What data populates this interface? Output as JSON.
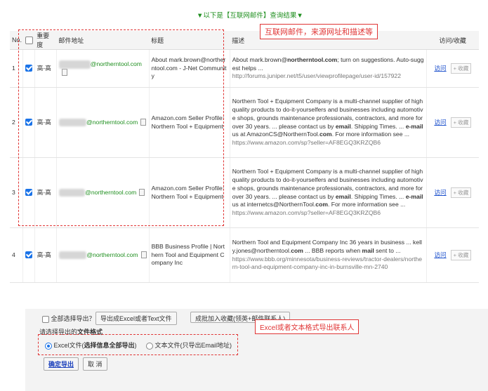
{
  "banner": "▼以下是【互联网邮件】查询结果▼",
  "columns": {
    "no": "No.",
    "importance": "重要度",
    "email": "邮件地址",
    "title": "标题",
    "desc": "描述",
    "action": "访问/收藏"
  },
  "rows": [
    {
      "no": "1",
      "importance": "高-高",
      "email_hidden": "mark.brown",
      "email_visible": "@northerntool.com",
      "title": "About mark.brown@northerntool.com - J-Net Community",
      "desc_html": "About mark.brown@<b>northerntool.com</b>; turn on suggestions. Auto-suggest helps ...",
      "url": "http://forums.juniper.net/t5/user/viewprofilepage/user-id/157922",
      "visit": "访问",
      "fav": "+ 收藏"
    },
    {
      "no": "2",
      "importance": "高-高",
      "email_hidden": "amazoncs",
      "email_visible": "@northerntool.com",
      "title": "Amazon.com Seller Profile: Northern Tool + Equipment",
      "desc_html": "Northern Tool + Equipment Company is a multi-channel supplier of high quality products to do-it-yourselfers and businesses including automotive shops, grounds maintenance professionals, contractors, and more for over 30 years. ... please contact us by <b>email</b>. Shipping Times. ... <b>e-mail</b> us at AmazonCS@NorthernTool.<b>com</b>. For more information see ...",
      "url": "https://www.amazon.com/sp?seller=AF8EGQ3KRZQB6",
      "visit": "访问",
      "fav": "+ 收藏"
    },
    {
      "no": "3",
      "importance": "高-高",
      "email_hidden": "internetcs",
      "email_visible": "@northerntool.com",
      "title": "Amazon.com Seller Profile: Northern Tool + Equipment",
      "desc_html": "Northern Tool + Equipment Company is a multi-channel supplier of high quality products to do-it-yourselfers and businesses including automotive shops, grounds maintenance professionals, contractors, and more for over 30 years. ... please contact us by <b>email</b>. Shipping Times. ... <b>e-mail</b> us at internetcs@NorthernTool.<b>com</b>. For more information see ...",
      "url": "https://www.amazon.com/sp?seller=AF8EGQ3KRZQB6",
      "visit": "访问",
      "fav": "+ 收藏"
    },
    {
      "no": "4",
      "importance": "高-高",
      "email_hidden": "kelly.jones",
      "email_visible": "@northerntool.com",
      "title": "BBB Business Profile | Northern Tool and Equipment Company Inc",
      "desc_html": "Northern Tool and Equipment Company Inc 36 years in business ... kelly.jones@northerntool.<b>com</b> ... BBB reports when <b>mail</b> sent to ...",
      "url": "https://www.bbb.org/minnesota/business-reviews/tractor-dealers/northern-tool-and-equipment-company-inc-in-burnsville-mn-2740",
      "visit": "访问",
      "fav": "+ 收藏"
    }
  ],
  "annotations": {
    "top": "互联网邮件，来源网址和描述等",
    "bottom": "Excel或者文本格式导出联系人"
  },
  "export": {
    "select_all": "全部选择导出？",
    "btn_export": "导出成Excel或者Text文件",
    "btn_batch": "成批加入收藏(领英+邮件联系人)",
    "format_prompt": "请选择导出的",
    "format_bold": "文件格式",
    "opt_excel": "Excel文件(",
    "opt_excel_bold": "选择信息全部导出",
    "opt_excel_end": ")",
    "opt_text": "文本文件(只导出Email地址)",
    "confirm": "确定导出",
    "cancel": "取 消"
  }
}
